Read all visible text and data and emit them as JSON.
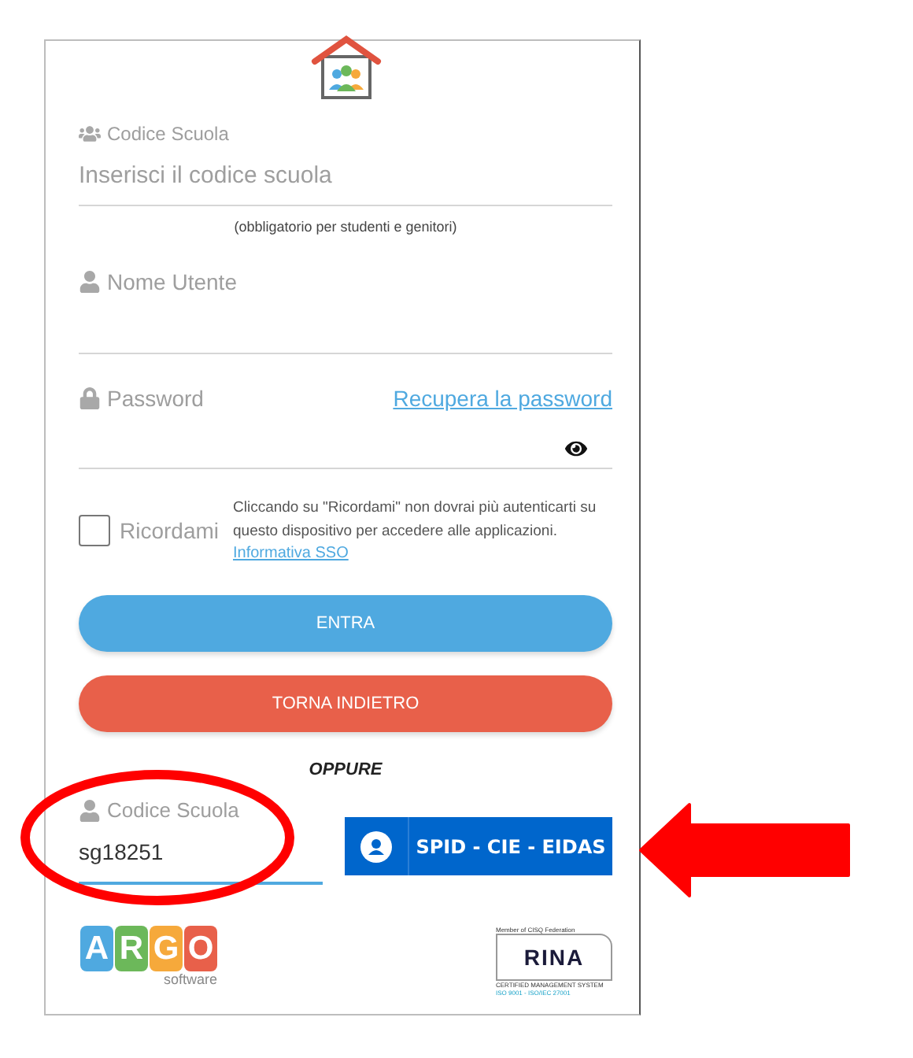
{
  "school_code": {
    "label": "Codice Scuola",
    "placeholder": "Inserisci il codice scuola",
    "note": "(obbligatorio per studenti e genitori)"
  },
  "username": {
    "label": "Nome Utente"
  },
  "password": {
    "label": "Password",
    "recover_link": "Recupera la password"
  },
  "remember": {
    "label": "Ricordami",
    "checked": false,
    "info": "Cliccando su \"Ricordami\" non dovrai più autenticarti su questo dispositivo per accedere alle applicazioni.",
    "info_link": "Informativa SSO"
  },
  "buttons": [
    {
      "label": "ENTRA",
      "kind": "primary"
    },
    {
      "label": "TORNA INDIETRO",
      "kind": "back"
    }
  ],
  "separator": "OPPURE",
  "spid": {
    "label": "Codice Scuola",
    "value": "sg18251",
    "button": "SPID - CIE - EIDAS"
  },
  "footer": {
    "argo_letters": [
      {
        "letter": "A",
        "color": "#4fa9e0"
      },
      {
        "letter": "R",
        "color": "#6cb85a"
      },
      {
        "letter": "G",
        "color": "#f6a93b"
      },
      {
        "letter": "O",
        "color": "#e8604a"
      }
    ],
    "argo_sub": "software",
    "rina": {
      "top": "Member of CISQ Federation",
      "name": "RINA",
      "cert": "CERTIFIED MANAGEMENT SYSTEM",
      "iso": "ISO 9001 - ISO/IEC 27001"
    }
  }
}
